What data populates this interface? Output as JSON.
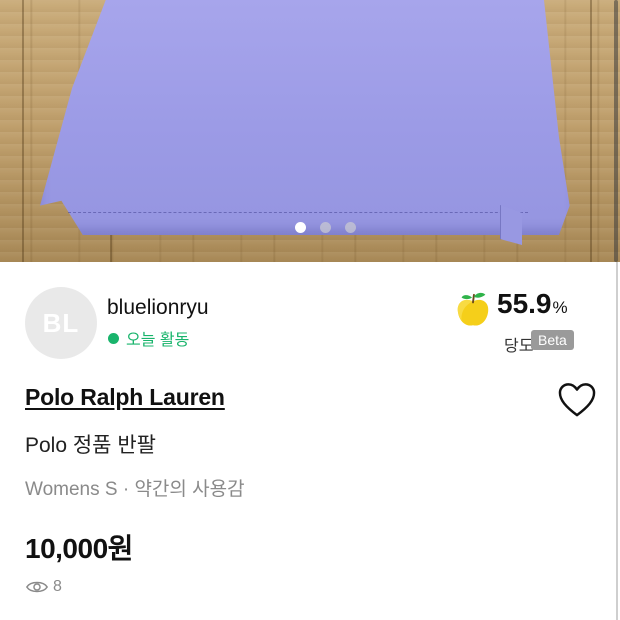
{
  "gallery": {
    "image_subject": "shirt",
    "total_images": 3,
    "active_index": 0
  },
  "seller": {
    "avatar_initials": "BL",
    "username": "bluelionryu",
    "activity_status": "오늘 활동",
    "status_color": "#19b46c"
  },
  "sweetness": {
    "icon": "apple-icon",
    "value": "55.9",
    "unit": "%",
    "label": "당도",
    "badge": "Beta"
  },
  "product": {
    "brand": "Polo Ralph Lauren",
    "title": "Polo 정품 반팔",
    "meta": "Womens S · 약간의 사용감",
    "price": "10,000원",
    "views": "8",
    "like_icon": "heart-outline-icon",
    "view_icon": "eye-icon"
  }
}
